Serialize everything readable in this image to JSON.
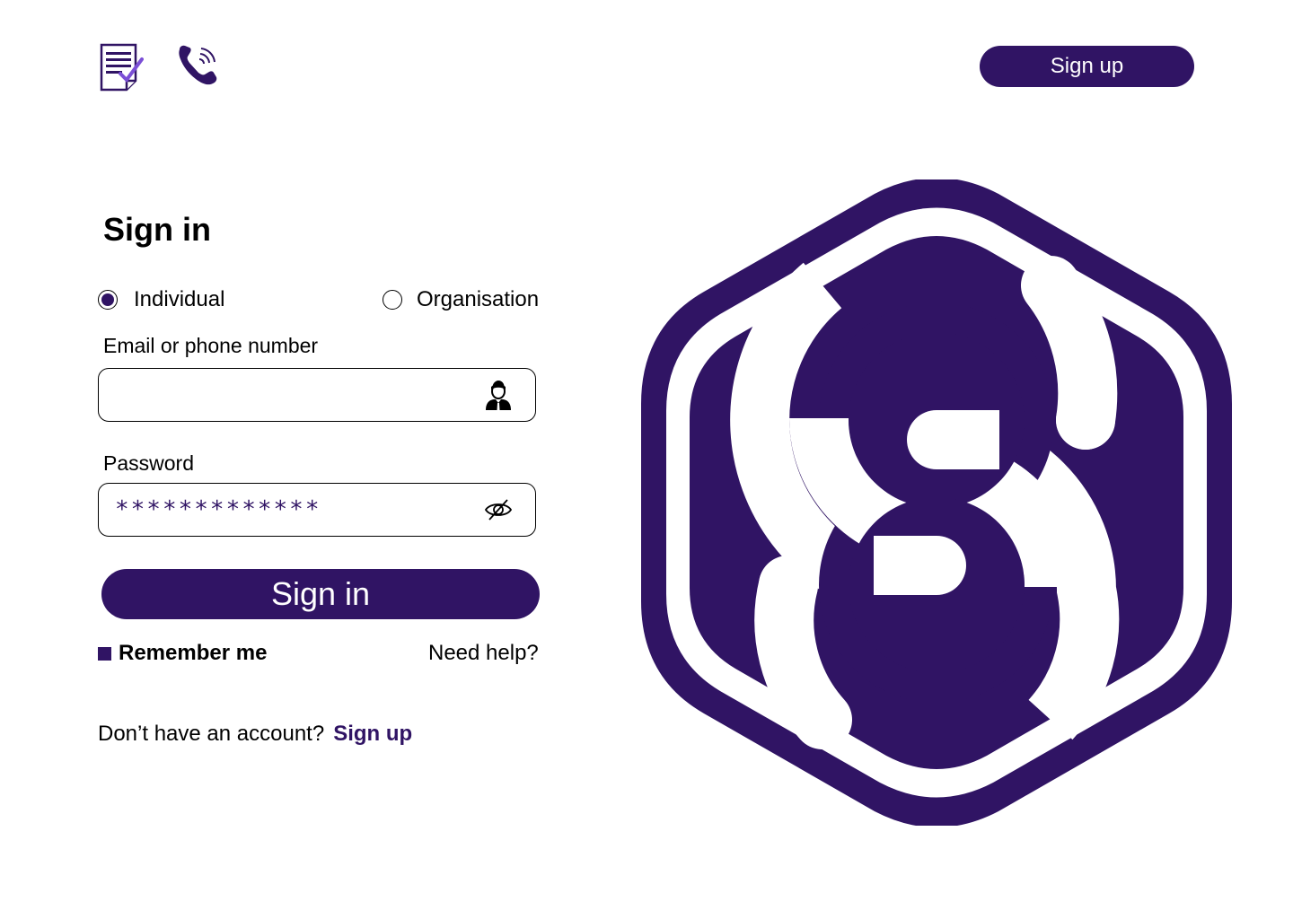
{
  "header": {
    "signup_label": "Sign up",
    "icons": [
      "document-check-icon",
      "phone-ringing-icon"
    ]
  },
  "signin": {
    "title": "Sign in",
    "account_types": [
      {
        "label": "Individual",
        "selected": true
      },
      {
        "label": "Organisation",
        "selected": false
      }
    ],
    "email_label": "Email or phone number",
    "email_value": "",
    "password_label": "Password",
    "password_value": "*************",
    "button_label": "Sign in",
    "remember_label": "Remember me",
    "remember_checked": true,
    "help_label": "Need help?",
    "no_account_text": "Don’t have an account?",
    "signup_link": "Sign up"
  },
  "logo": {
    "name": "hexagon-s-logo-icon"
  },
  "colors": {
    "brand": "#301464",
    "background": "#ffffff",
    "text": "#000000"
  }
}
